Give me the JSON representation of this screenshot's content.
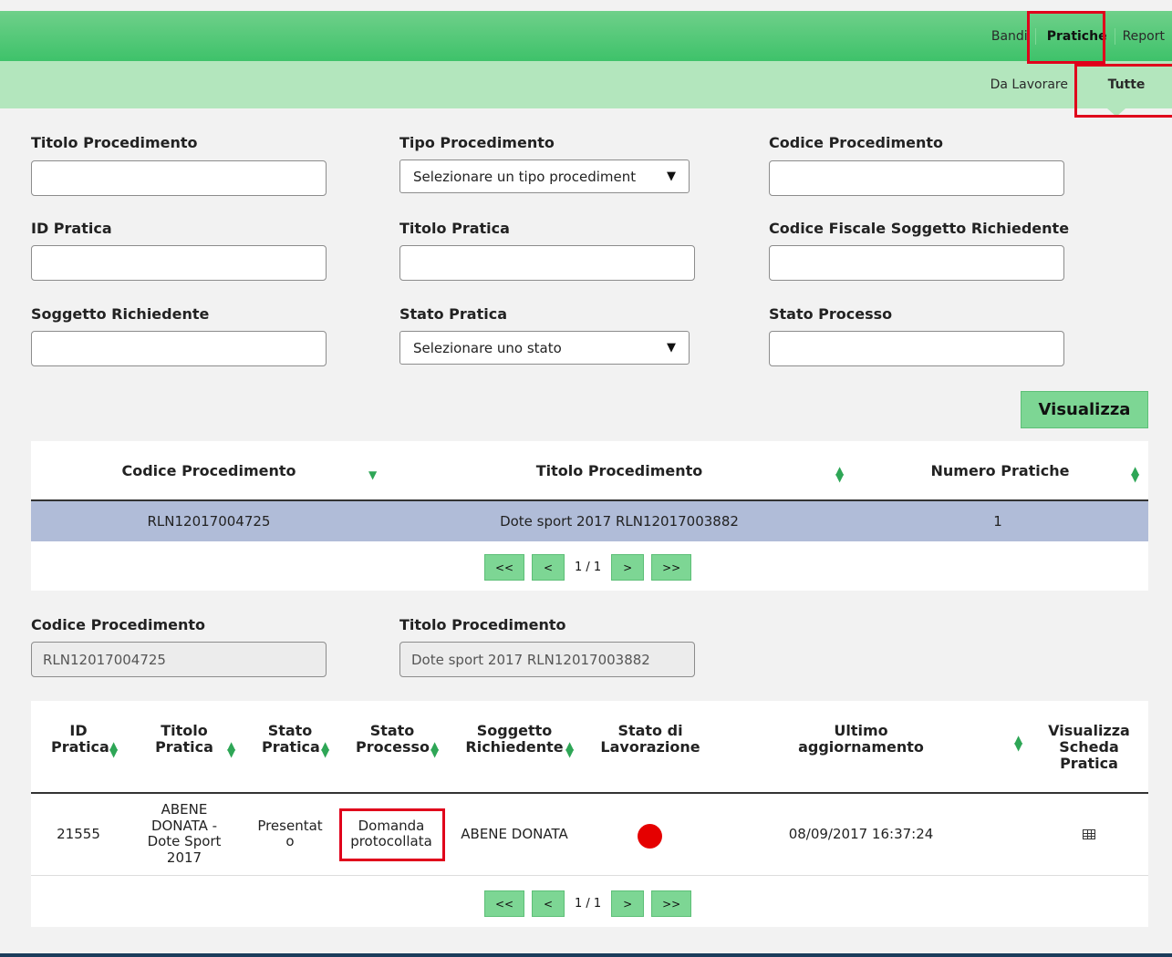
{
  "nav": {
    "top": [
      "Bandi",
      "Pratiche",
      "Report"
    ],
    "sub": [
      "Da Lavorare",
      "Tutte"
    ]
  },
  "filters": {
    "titolo_procedimento": "Titolo Procedimento",
    "tipo_procedimento": "Tipo Procedimento",
    "tipo_procedimento_value": "Selezionare un tipo procediment",
    "codice_procedimento": "Codice Procedimento",
    "id_pratica": "ID Pratica",
    "titolo_pratica": "Titolo Pratica",
    "codice_fiscale": "Codice Fiscale Soggetto Richiedente",
    "soggetto_richiedente": "Soggetto Richiedente",
    "stato_pratica": "Stato Pratica",
    "stato_pratica_value": "Selezionare uno stato",
    "stato_processo": "Stato Processo",
    "button": "Visualizza"
  },
  "proc_table": {
    "headers": [
      "Codice Procedimento",
      "Titolo Procedimento",
      "Numero Pratiche"
    ],
    "row": [
      "RLN12017004725",
      "Dote sport 2017 RLN12017003882",
      "1"
    ],
    "pager": {
      "first": "<<",
      "prev": "<",
      "info": "1 / 1",
      "next": ">",
      "last": ">>"
    }
  },
  "detail": {
    "codice_label": "Codice Procedimento",
    "codice_value": "RLN12017004725",
    "titolo_label": "Titolo Procedimento",
    "titolo_value": "Dote sport 2017 RLN12017003882"
  },
  "prat_table": {
    "headers": {
      "id": "ID\nPratica",
      "titolo": "Titolo\nPratica",
      "stato_pratica": "Stato\nPratica",
      "stato_processo": "Stato\nProcesso",
      "soggetto": "Soggetto\nRichiedente",
      "stato_lav": "Stato di\nLavorazione",
      "ultimo": "Ultimo aggiornamento",
      "visualizza": "Visualizza\nScheda\nPratica"
    },
    "row": {
      "id": "21555",
      "titolo": "ABENE\nDONATA -\nDote Sport\n2017",
      "stato_pratica": "Presentat\no",
      "stato_processo": "Domanda\nprotocollata",
      "soggetto": "ABENE DONATA",
      "stato_lav_color": "#e50000",
      "ultimo": "08/09/2017 16:37:24",
      "visualizza_icon": "table-icon"
    },
    "pager": {
      "first": "<<",
      "prev": "<",
      "info": "1 / 1",
      "next": ">",
      "last": ">>"
    }
  },
  "colors": {
    "accent_green": "#7dd694",
    "highlight_red": "#e0001b",
    "selected_row": "#b0bcd8"
  }
}
